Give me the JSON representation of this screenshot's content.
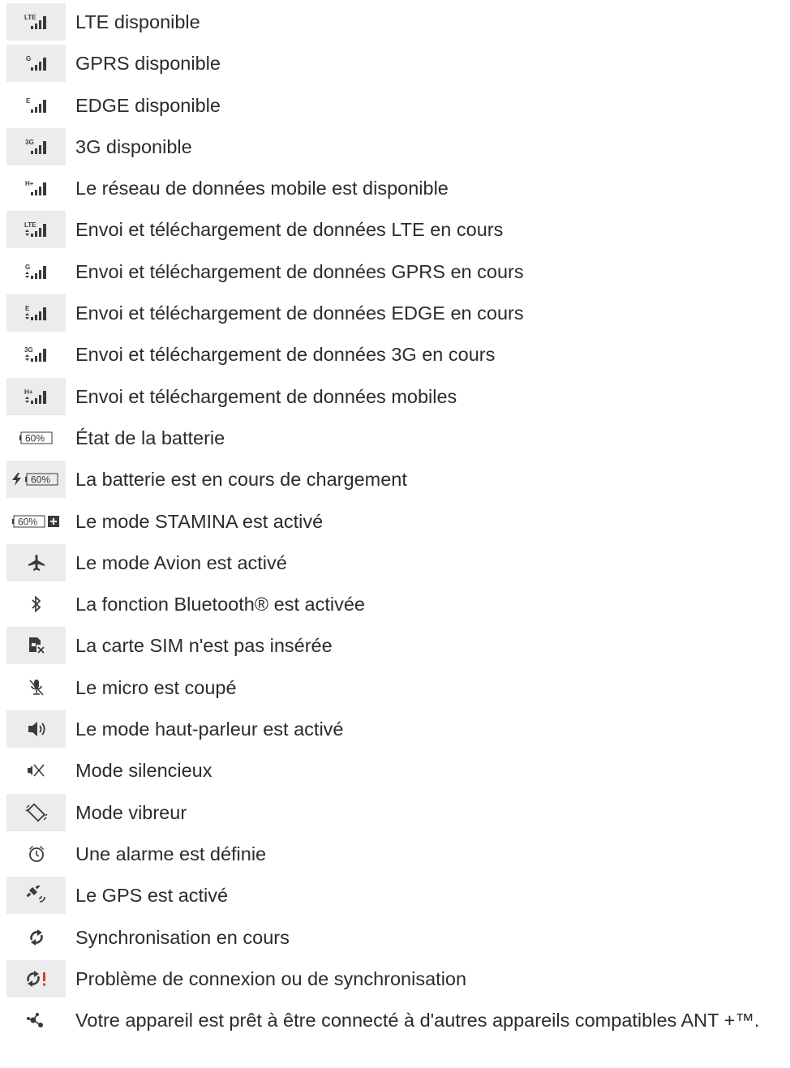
{
  "rows": [
    {
      "label": "LTE disponible",
      "icon": "lte-signal-icon",
      "badge": "LTE"
    },
    {
      "label": "GPRS disponible",
      "icon": "gprs-signal-icon",
      "badge": "G"
    },
    {
      "label": "EDGE disponible",
      "icon": "edge-signal-icon",
      "badge": "E"
    },
    {
      "label": "3G disponible",
      "icon": "3g-signal-icon",
      "badge": "3G"
    },
    {
      "label": "Le réseau de données mobile est disponible",
      "icon": "hplus-signal-icon",
      "badge": "H+"
    },
    {
      "label": "Envoi et téléchargement de données LTE en cours",
      "icon": "lte-transfer-icon",
      "badge": "LTE"
    },
    {
      "label": "Envoi et téléchargement de données GPRS en cours",
      "icon": "gprs-transfer-icon",
      "badge": "G"
    },
    {
      "label": "Envoi et téléchargement de données EDGE en cours",
      "icon": "edge-transfer-icon",
      "badge": "E"
    },
    {
      "label": "Envoi et téléchargement de données 3G en cours",
      "icon": "3g-transfer-icon",
      "badge": "3G"
    },
    {
      "label": "Envoi et téléchargement de données mobiles",
      "icon": "hplus-transfer-icon",
      "badge": "H+"
    },
    {
      "label": "État de la batterie",
      "icon": "battery-icon",
      "badge": "60%"
    },
    {
      "label": "La batterie est en cours de chargement",
      "icon": "battery-charging-icon",
      "badge": "60%"
    },
    {
      "label": "Le mode STAMINA est activé",
      "icon": "stamina-battery-icon",
      "badge": "60%"
    },
    {
      "label": "Le mode Avion est activé",
      "icon": "airplane-icon"
    },
    {
      "label": "La fonction Bluetooth® est activée",
      "icon": "bluetooth-icon"
    },
    {
      "label": "La carte SIM n'est pas insérée",
      "icon": "no-sim-icon"
    },
    {
      "label": "Le micro est coupé",
      "icon": "mic-muted-icon"
    },
    {
      "label": "Le mode haut-parleur est activé",
      "icon": "speaker-icon"
    },
    {
      "label": "Mode silencieux",
      "icon": "silent-icon"
    },
    {
      "label": "Mode vibreur",
      "icon": "vibrate-icon"
    },
    {
      "label": "Une alarme est définie",
      "icon": "alarm-icon"
    },
    {
      "label": "Le GPS est activé",
      "icon": "gps-icon"
    },
    {
      "label": "Synchronisation en cours",
      "icon": "sync-icon"
    },
    {
      "label": "Problème de connexion ou de synchronisation",
      "icon": "sync-error-icon"
    },
    {
      "label": "Votre appareil est prêt à être connecté à d'autres appareils compatibles ANT +™.",
      "icon": "ant-plus-icon"
    }
  ],
  "colors": {
    "shade": "#ececec",
    "text": "#2b2b2b",
    "icon": "#3a3a3a",
    "alert": "#e03a2a"
  }
}
